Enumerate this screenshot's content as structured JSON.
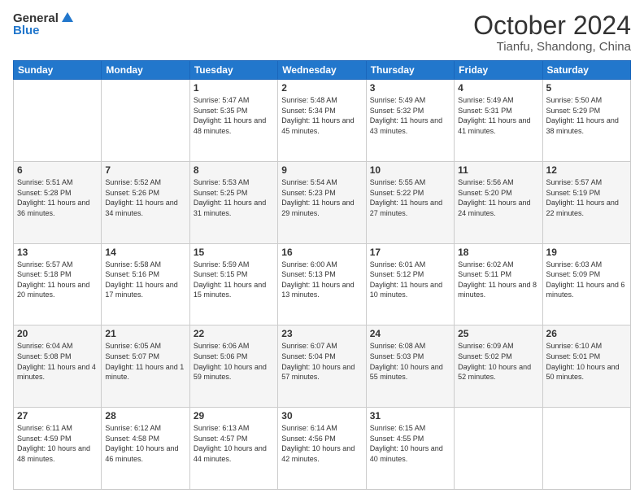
{
  "header": {
    "logo_general": "General",
    "logo_blue": "Blue",
    "main_title": "October 2024",
    "sub_title": "Tianfu, Shandong, China"
  },
  "calendar": {
    "headers": [
      "Sunday",
      "Monday",
      "Tuesday",
      "Wednesday",
      "Thursday",
      "Friday",
      "Saturday"
    ],
    "rows": [
      [
        {
          "day": "",
          "sunrise": "",
          "sunset": "",
          "daylight": ""
        },
        {
          "day": "",
          "sunrise": "",
          "sunset": "",
          "daylight": ""
        },
        {
          "day": "1",
          "sunrise": "Sunrise: 5:47 AM",
          "sunset": "Sunset: 5:35 PM",
          "daylight": "Daylight: 11 hours and 48 minutes."
        },
        {
          "day": "2",
          "sunrise": "Sunrise: 5:48 AM",
          "sunset": "Sunset: 5:34 PM",
          "daylight": "Daylight: 11 hours and 45 minutes."
        },
        {
          "day": "3",
          "sunrise": "Sunrise: 5:49 AM",
          "sunset": "Sunset: 5:32 PM",
          "daylight": "Daylight: 11 hours and 43 minutes."
        },
        {
          "day": "4",
          "sunrise": "Sunrise: 5:49 AM",
          "sunset": "Sunset: 5:31 PM",
          "daylight": "Daylight: 11 hours and 41 minutes."
        },
        {
          "day": "5",
          "sunrise": "Sunrise: 5:50 AM",
          "sunset": "Sunset: 5:29 PM",
          "daylight": "Daylight: 11 hours and 38 minutes."
        }
      ],
      [
        {
          "day": "6",
          "sunrise": "Sunrise: 5:51 AM",
          "sunset": "Sunset: 5:28 PM",
          "daylight": "Daylight: 11 hours and 36 minutes."
        },
        {
          "day": "7",
          "sunrise": "Sunrise: 5:52 AM",
          "sunset": "Sunset: 5:26 PM",
          "daylight": "Daylight: 11 hours and 34 minutes."
        },
        {
          "day": "8",
          "sunrise": "Sunrise: 5:53 AM",
          "sunset": "Sunset: 5:25 PM",
          "daylight": "Daylight: 11 hours and 31 minutes."
        },
        {
          "day": "9",
          "sunrise": "Sunrise: 5:54 AM",
          "sunset": "Sunset: 5:23 PM",
          "daylight": "Daylight: 11 hours and 29 minutes."
        },
        {
          "day": "10",
          "sunrise": "Sunrise: 5:55 AM",
          "sunset": "Sunset: 5:22 PM",
          "daylight": "Daylight: 11 hours and 27 minutes."
        },
        {
          "day": "11",
          "sunrise": "Sunrise: 5:56 AM",
          "sunset": "Sunset: 5:20 PM",
          "daylight": "Daylight: 11 hours and 24 minutes."
        },
        {
          "day": "12",
          "sunrise": "Sunrise: 5:57 AM",
          "sunset": "Sunset: 5:19 PM",
          "daylight": "Daylight: 11 hours and 22 minutes."
        }
      ],
      [
        {
          "day": "13",
          "sunrise": "Sunrise: 5:57 AM",
          "sunset": "Sunset: 5:18 PM",
          "daylight": "Daylight: 11 hours and 20 minutes."
        },
        {
          "day": "14",
          "sunrise": "Sunrise: 5:58 AM",
          "sunset": "Sunset: 5:16 PM",
          "daylight": "Daylight: 11 hours and 17 minutes."
        },
        {
          "day": "15",
          "sunrise": "Sunrise: 5:59 AM",
          "sunset": "Sunset: 5:15 PM",
          "daylight": "Daylight: 11 hours and 15 minutes."
        },
        {
          "day": "16",
          "sunrise": "Sunrise: 6:00 AM",
          "sunset": "Sunset: 5:13 PM",
          "daylight": "Daylight: 11 hours and 13 minutes."
        },
        {
          "day": "17",
          "sunrise": "Sunrise: 6:01 AM",
          "sunset": "Sunset: 5:12 PM",
          "daylight": "Daylight: 11 hours and 10 minutes."
        },
        {
          "day": "18",
          "sunrise": "Sunrise: 6:02 AM",
          "sunset": "Sunset: 5:11 PM",
          "daylight": "Daylight: 11 hours and 8 minutes."
        },
        {
          "day": "19",
          "sunrise": "Sunrise: 6:03 AM",
          "sunset": "Sunset: 5:09 PM",
          "daylight": "Daylight: 11 hours and 6 minutes."
        }
      ],
      [
        {
          "day": "20",
          "sunrise": "Sunrise: 6:04 AM",
          "sunset": "Sunset: 5:08 PM",
          "daylight": "Daylight: 11 hours and 4 minutes."
        },
        {
          "day": "21",
          "sunrise": "Sunrise: 6:05 AM",
          "sunset": "Sunset: 5:07 PM",
          "daylight": "Daylight: 11 hours and 1 minute."
        },
        {
          "day": "22",
          "sunrise": "Sunrise: 6:06 AM",
          "sunset": "Sunset: 5:06 PM",
          "daylight": "Daylight: 10 hours and 59 minutes."
        },
        {
          "day": "23",
          "sunrise": "Sunrise: 6:07 AM",
          "sunset": "Sunset: 5:04 PM",
          "daylight": "Daylight: 10 hours and 57 minutes."
        },
        {
          "day": "24",
          "sunrise": "Sunrise: 6:08 AM",
          "sunset": "Sunset: 5:03 PM",
          "daylight": "Daylight: 10 hours and 55 minutes."
        },
        {
          "day": "25",
          "sunrise": "Sunrise: 6:09 AM",
          "sunset": "Sunset: 5:02 PM",
          "daylight": "Daylight: 10 hours and 52 minutes."
        },
        {
          "day": "26",
          "sunrise": "Sunrise: 6:10 AM",
          "sunset": "Sunset: 5:01 PM",
          "daylight": "Daylight: 10 hours and 50 minutes."
        }
      ],
      [
        {
          "day": "27",
          "sunrise": "Sunrise: 6:11 AM",
          "sunset": "Sunset: 4:59 PM",
          "daylight": "Daylight: 10 hours and 48 minutes."
        },
        {
          "day": "28",
          "sunrise": "Sunrise: 6:12 AM",
          "sunset": "Sunset: 4:58 PM",
          "daylight": "Daylight: 10 hours and 46 minutes."
        },
        {
          "day": "29",
          "sunrise": "Sunrise: 6:13 AM",
          "sunset": "Sunset: 4:57 PM",
          "daylight": "Daylight: 10 hours and 44 minutes."
        },
        {
          "day": "30",
          "sunrise": "Sunrise: 6:14 AM",
          "sunset": "Sunset: 4:56 PM",
          "daylight": "Daylight: 10 hours and 42 minutes."
        },
        {
          "day": "31",
          "sunrise": "Sunrise: 6:15 AM",
          "sunset": "Sunset: 4:55 PM",
          "daylight": "Daylight: 10 hours and 40 minutes."
        },
        {
          "day": "",
          "sunrise": "",
          "sunset": "",
          "daylight": ""
        },
        {
          "day": "",
          "sunrise": "",
          "sunset": "",
          "daylight": ""
        }
      ]
    ]
  }
}
